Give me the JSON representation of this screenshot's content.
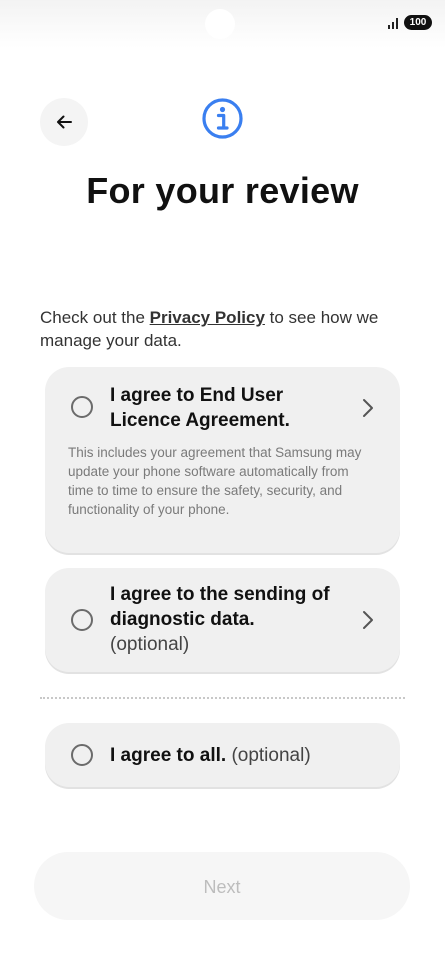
{
  "status_bar": {
    "battery": "100"
  },
  "header": {
    "back_icon": "arrow-left-icon",
    "info_icon": "info-circle-icon",
    "title": "For your review"
  },
  "intro": {
    "prefix": "Check out the ",
    "link": "Privacy Policy",
    "suffix": " to see how we manage your data."
  },
  "consents": {
    "eula": {
      "label": "I agree to End User Licence Agreement.",
      "description": "This includes your agreement that Samsung may update your phone software automatically from time to time to ensure the safety, security, and functionality of your phone.",
      "checked": false
    },
    "diagnostic": {
      "label": "I agree to the sending of diagnostic data.",
      "optional": "(optional)",
      "checked": false
    },
    "all": {
      "label": "I agree to all.",
      "optional": "(optional)",
      "checked": false
    }
  },
  "footer": {
    "next_label": "Next",
    "next_enabled": false
  },
  "colors": {
    "accent": "#3a7ff0",
    "card_bg": "#f0f0f0",
    "disabled_text": "#bdbdbd"
  }
}
